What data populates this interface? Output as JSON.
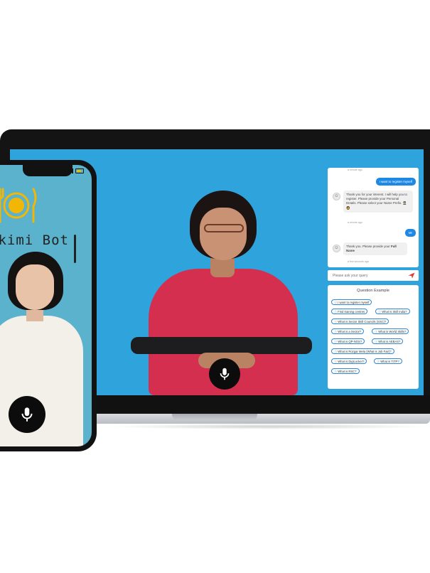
{
  "laptop": {
    "chat": {
      "messages": [
        {
          "time": "a minute ago"
        },
        {
          "role": "user",
          "text": "I want to register myself"
        },
        {
          "role": "bot",
          "text": "Thank you for your interest. I will help you to register. Please provide your Personal Details. Please select your Name Prefix.",
          "emoji": "👮 🧔",
          "time": "a minute ago"
        },
        {
          "role": "user",
          "text": "Mr"
        },
        {
          "role": "bot",
          "text_prefix": "Thank you. Please provide your ",
          "text_bold": "Full Name",
          "time": "a few seconds ago"
        }
      ],
      "input_placeholder": "Please ask your query",
      "send_icon": "send-icon"
    },
    "questions": {
      "title": "Question Example",
      "items": [
        "I want to register myself",
        "Find training centres",
        "What is Skill India?",
        "What is Sector Skill Councils (SSC)?",
        "What is a Sector?",
        "What is World Skills?",
        "What is QP-NOS?",
        "What is AEBAS?",
        "What is Rozgar Mela (What is Job Fair)?",
        "What is DigiLocker?",
        "What is TITP?",
        "What is RSC?"
      ]
    },
    "mic_icon": "microphone-icon"
  },
  "phone": {
    "bot_name": "akimi Bot",
    "logo_icon": "plate-fork-knife-icon",
    "mic_icon": "microphone-icon"
  },
  "colors": {
    "laptop_bg": "#2fa3dc",
    "phone_bg": "#5bb2cd",
    "accent": "#1e88e5",
    "logo": "#f2b705"
  }
}
